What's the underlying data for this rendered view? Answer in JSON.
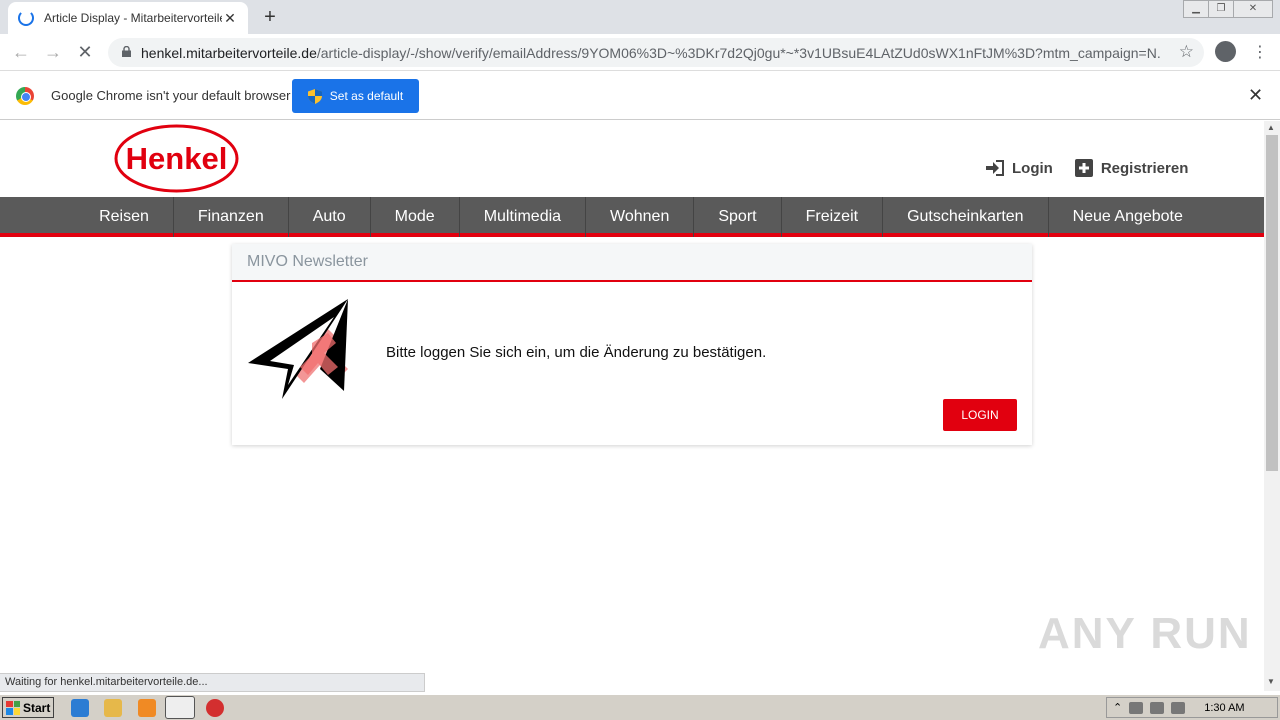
{
  "browser": {
    "tab_title": "Article Display - Mitarbeitervorteile",
    "url_host": "henkel.mitarbeitervorteile.de",
    "url_path": "/article-display/-/show/verify/emailAddress/9YOM06%3D~%3DKr7d2Qj0gu*~*3v1UBsuE4LAtZUd0sWX1nFtJM%3D?mtm_campaign=N...",
    "infobar_text": "Google Chrome isn't your default browser",
    "set_default_label": "Set as default",
    "status_text": "Waiting for henkel.mitarbeitervorteile.de..."
  },
  "site": {
    "logo_text": "Henkel",
    "login_label": "Login",
    "register_label": "Registrieren",
    "nav": [
      "Reisen",
      "Finanzen",
      "Auto",
      "Mode",
      "Multimedia",
      "Wohnen",
      "Sport",
      "Freizeit",
      "Gutscheinkarten",
      "Neue Angebote"
    ],
    "brand_color": "#e1000f",
    "nav_bg": "#5a5a5a"
  },
  "card": {
    "title": "MIVO Newsletter",
    "message": "Bitte loggen Sie sich ein, um die Änderung zu bestätigen.",
    "button": "LOGIN"
  },
  "watermark": "ANY RUN",
  "taskbar": {
    "start_label": "Start",
    "clock": "1:30 AM"
  }
}
